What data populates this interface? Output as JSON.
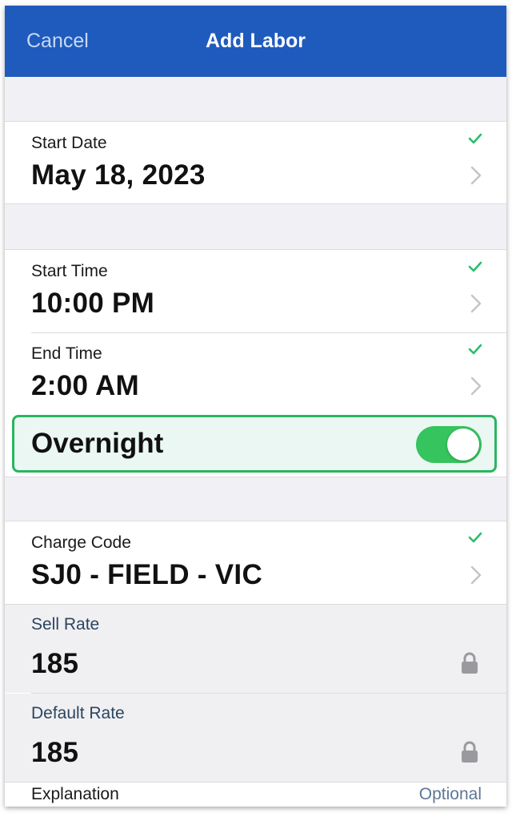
{
  "navbar": {
    "cancel_label": "Cancel",
    "title": "Add Labor"
  },
  "start_date": {
    "label": "Start Date",
    "value": "May 18, 2023"
  },
  "start_time": {
    "label": "Start Time",
    "value": "10:00 PM"
  },
  "end_time": {
    "label": "End Time",
    "value": "2:00 AM"
  },
  "overnight": {
    "label": "Overnight",
    "enabled": true
  },
  "charge_code": {
    "label": "Charge Code",
    "value": "SJ0 - FIELD - VIC"
  },
  "sell_rate": {
    "label": "Sell Rate",
    "value": "185"
  },
  "default_rate": {
    "label": "Default Rate",
    "value": "185"
  },
  "explanation": {
    "label": "Explanation",
    "placeholder": "Optional"
  },
  "colors": {
    "navbar": "#1f5bbd",
    "check": "#2dbd6b",
    "toggle_on": "#35c45e",
    "highlight_border": "#29b55f"
  },
  "icons": [
    "check-icon",
    "chevron-right-icon",
    "lock-icon"
  ]
}
